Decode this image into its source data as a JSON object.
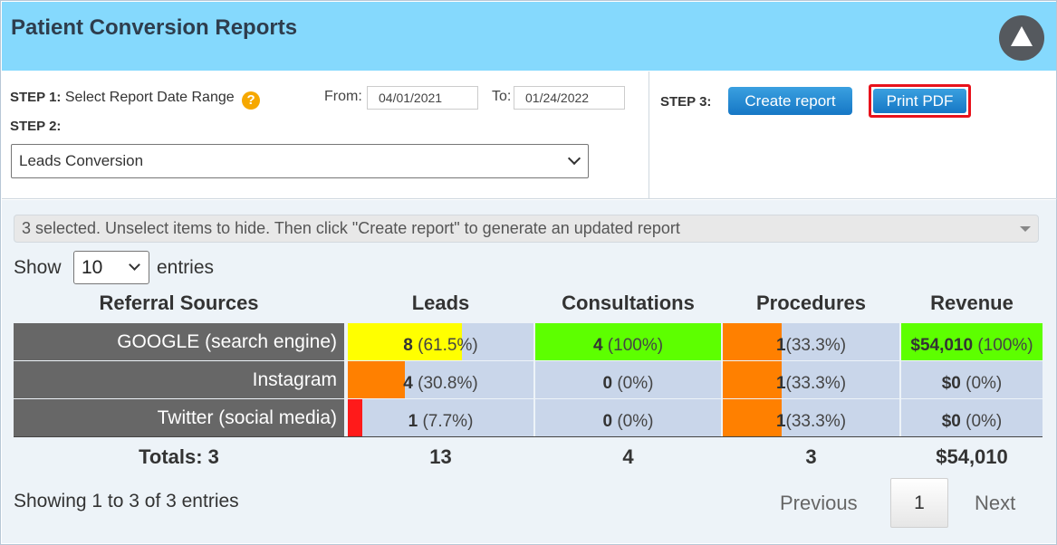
{
  "header": {
    "title": "Patient Conversion Reports"
  },
  "controls": {
    "step1_label": "STEP 1:",
    "step1_text": "Select Report Date Range",
    "help_glyph": "?",
    "from_label": "From:",
    "from_value": "04/01/2021",
    "to_label": "To:",
    "to_value": "01/24/2022",
    "step2_label": "STEP 2:",
    "report_type": "Leads Conversion",
    "step3_label": "STEP 3:",
    "create_label": "Create report",
    "print_label": "Print PDF"
  },
  "filter": {
    "multi_select_text": "3 selected. Unselect items to hide. Then click \"Create report\" to generate an updated report"
  },
  "length": {
    "show_label": "Show",
    "value": "10",
    "entries_label": "entries"
  },
  "table": {
    "headers": [
      "Referral Sources",
      "Leads",
      "Consultations",
      "Procedures",
      "Revenue"
    ],
    "rows": [
      {
        "source": "GOOGLE (search engine)",
        "leads": {
          "value": "8",
          "pct": "(61.5%)"
        },
        "consultations": {
          "value": "4",
          "pct": "(100%)"
        },
        "procedures": {
          "value": "1",
          "pct": "(33.3%)"
        },
        "revenue": {
          "value": "$54,010",
          "pct": "(100%)"
        }
      },
      {
        "source": "Instagram",
        "leads": {
          "value": "4",
          "pct": "(30.8%)"
        },
        "consultations": {
          "value": "0",
          "pct": "(0%)"
        },
        "procedures": {
          "value": "1",
          "pct": "(33.3%)"
        },
        "revenue": {
          "value": "$0",
          "pct": "(0%)"
        }
      },
      {
        "source": "Twitter (social media)",
        "leads": {
          "value": "1",
          "pct": "(7.7%)"
        },
        "consultations": {
          "value": "0",
          "pct": "(0%)"
        },
        "procedures": {
          "value": "1",
          "pct": "(33.3%)"
        },
        "revenue": {
          "value": "$0",
          "pct": "(0%)"
        }
      }
    ],
    "totals": {
      "label": "Totals: 3",
      "leads": "13",
      "consultations": "4",
      "procedures": "3",
      "revenue": "$54,010"
    }
  },
  "colors": {
    "header_bg": "#85d9fd",
    "bar_yellow": "#ffff00",
    "bar_green": "#5dff00",
    "bar_orange": "#ff8000",
    "bar_red": "#ff1a1a",
    "cell_bg": "#c9d6ea",
    "source_bg": "#676767"
  },
  "footer": {
    "info": "Showing 1 to 3 of 3 entries",
    "previous": "Previous",
    "page": "1",
    "next": "Next"
  }
}
